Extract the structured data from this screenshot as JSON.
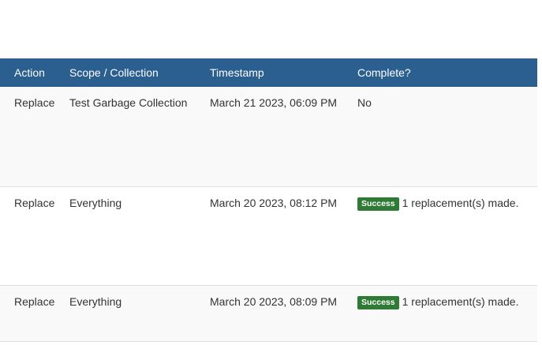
{
  "table": {
    "headers": {
      "action": "Action",
      "scope": "Scope / Collection",
      "timestamp": "Timestamp",
      "complete": "Complete?"
    },
    "rows": [
      {
        "action": "Replace",
        "scope": "Test Garbage Collection",
        "timestamp": "March 21 2023, 06:09 PM",
        "status_badge": "",
        "complete": "No"
      },
      {
        "action": "Replace",
        "scope": "Everything",
        "timestamp": "March 20 2023, 08:12 PM",
        "status_badge": "Success",
        "complete": "1 replacement(s) made."
      },
      {
        "action": "Replace",
        "scope": "Everything",
        "timestamp": "March 20 2023, 08:09 PM",
        "status_badge": "Success",
        "complete": "1 replacement(s) made."
      }
    ]
  },
  "colors": {
    "header_bg": "#2a5f8f",
    "success_badge": "#2f7a35"
  }
}
